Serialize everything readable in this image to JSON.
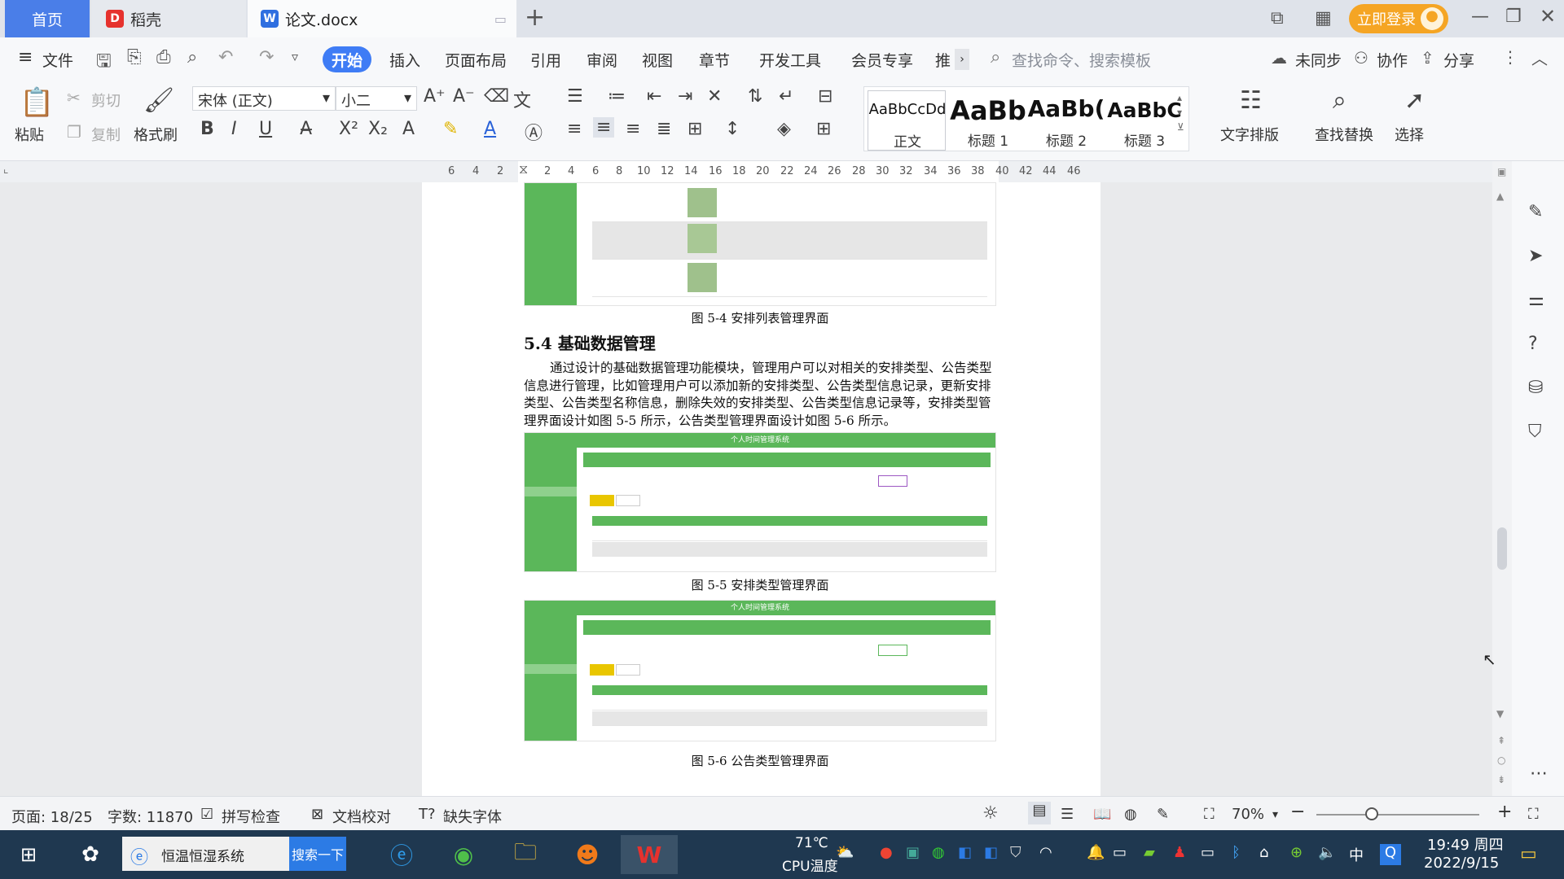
{
  "tabs": {
    "home": "首页",
    "daoke": "稻壳",
    "doc": "论文.docx",
    "new_tab": "+",
    "login": "立即登录"
  },
  "menu": {
    "file": "文件",
    "items": [
      "开始",
      "插入",
      "页面布局",
      "引用",
      "审阅",
      "视图",
      "章节",
      "开发工具",
      "会员专享",
      "推"
    ],
    "search_placeholder": "查找命令、搜索模板",
    "unsync": "未同步",
    "collab": "协作",
    "share": "分享"
  },
  "ribbon": {
    "paste": "粘贴",
    "cut": "剪切",
    "copy": "复制",
    "format_painter": "格式刷",
    "font_name": "宋体 (正文)",
    "font_size": "小二",
    "styles": [
      {
        "sample": "AaBbCcDd",
        "name": "正文"
      },
      {
        "sample": "AaBb",
        "name": "标题 1"
      },
      {
        "sample": "AaBb(",
        "name": "标题 2"
      },
      {
        "sample": "AaBbC",
        "name": "标题 3"
      }
    ],
    "text_layout": "文字排版",
    "find_replace": "查找替换",
    "select": "选择"
  },
  "ruler": [
    "6",
    "4",
    "2",
    "2",
    "4",
    "6",
    "8",
    "10",
    "12",
    "14",
    "16",
    "18",
    "20",
    "22",
    "24",
    "26",
    "28",
    "30",
    "32",
    "34",
    "36",
    "38",
    "40",
    "42",
    "44",
    "46"
  ],
  "document": {
    "caption_5_4": "图 5-4 安排列表管理界面",
    "heading": "5.4 基础数据管理",
    "paragraph": "通过设计的基础数据管理功能模块，管理用户可以对相关的安排类型、公告类型信息进行管理，比如管理用户可以添加新的安排类型、公告类型信息记录，更新安排类型、公告类型名称信息，删除失效的安排类型、公告类型信息记录等，安排类型管理界面设计如图 5-5 所示，公告类型管理界面设计如图 5-6 所示。",
    "caption_5_5": "图 5-5 安排类型管理界面",
    "caption_5_6": "图 5-6 公告类型管理界面",
    "shot_title": "个人时间管理系统"
  },
  "status": {
    "page": "页面: 18/25",
    "words": "字数: 11870",
    "spell": "拼写检查",
    "proof": "文档校对",
    "missing_font": "缺失字体",
    "zoom": "70%"
  },
  "taskbar": {
    "search_text": "恒温恒湿系统",
    "search_btn": "搜索一下",
    "temp": "71℃",
    "temp_label": "CPU温度",
    "ime": "中",
    "time": "19:49 周四",
    "date": "2022/9/15"
  }
}
